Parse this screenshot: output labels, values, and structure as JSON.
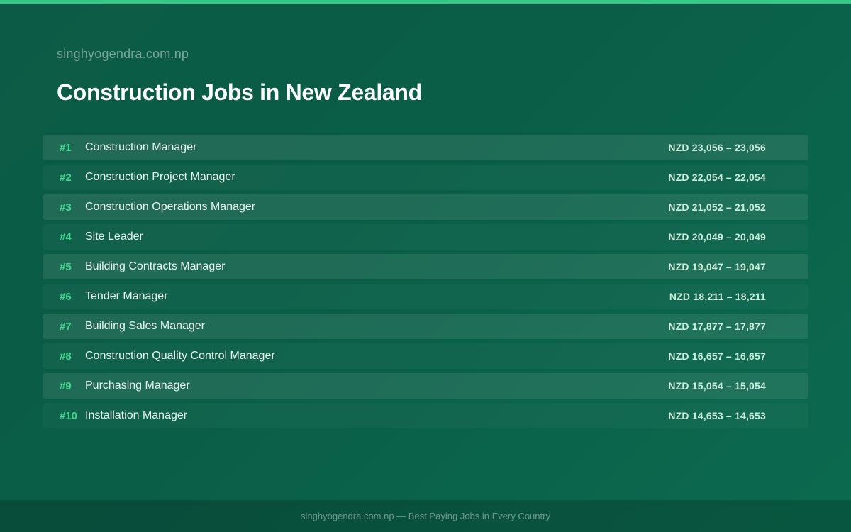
{
  "site_name": "singhyogendra.com.np",
  "title": "Construction Jobs in New Zealand",
  "jobs": [
    {
      "rank": "#1",
      "title": "Construction Manager",
      "salary": "NZD 23,056 – 23,056"
    },
    {
      "rank": "#2",
      "title": "Construction Project Manager",
      "salary": "NZD 22,054 – 22,054"
    },
    {
      "rank": "#3",
      "title": "Construction Operations Manager",
      "salary": "NZD 21,052 – 21,052"
    },
    {
      "rank": "#4",
      "title": "Site Leader",
      "salary": "NZD 20,049 – 20,049"
    },
    {
      "rank": "#5",
      "title": "Building Contracts Manager",
      "salary": "NZD 19,047 – 19,047"
    },
    {
      "rank": "#6",
      "title": "Tender Manager",
      "salary": "NZD 18,211 – 18,211"
    },
    {
      "rank": "#7",
      "title": "Building Sales Manager",
      "salary": "NZD 17,877 – 17,877"
    },
    {
      "rank": "#8",
      "title": "Construction Quality Control Manager",
      "salary": "NZD 16,657 – 16,657"
    },
    {
      "rank": "#9",
      "title": "Purchasing Manager",
      "salary": "NZD 15,054 – 15,054"
    },
    {
      "rank": "#10",
      "title": "Installation Manager",
      "salary": "NZD 14,653 – 14,653"
    }
  ],
  "footer": "singhyogendra.com.np — Best Paying Jobs in Every Country",
  "colors": {
    "background": "#0a5d47",
    "accent": "#35c986",
    "rank": "#42d790"
  }
}
